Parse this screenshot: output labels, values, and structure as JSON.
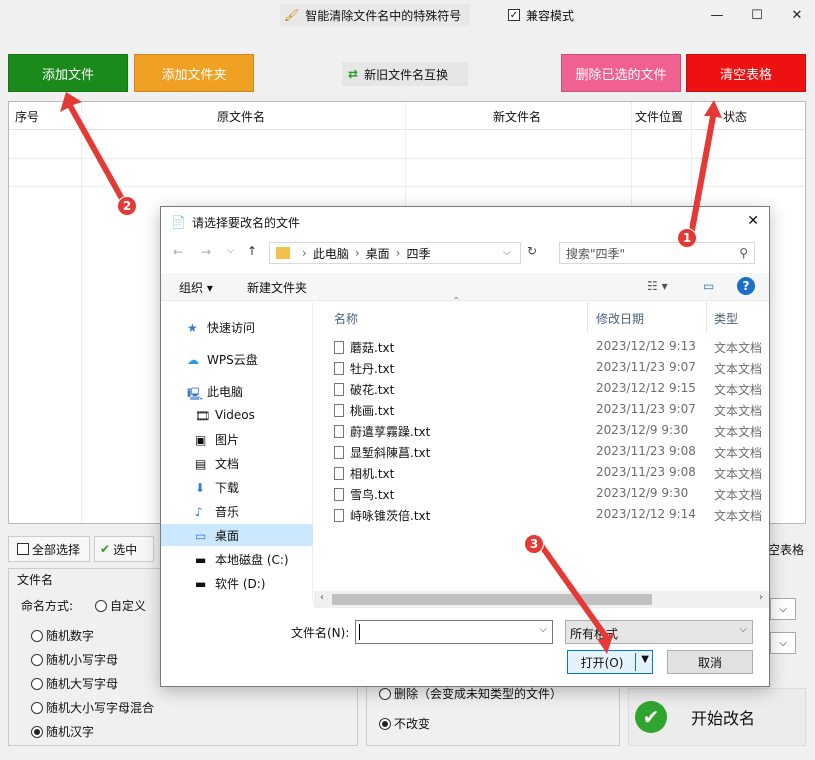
{
  "toolbar": {
    "special_char_btn": "智能清除文件名中的特殊符号",
    "compat_mode": "兼容模式",
    "add_file": "添加文件",
    "add_folder": "添加文件夹",
    "swap_names": "新旧文件名互换",
    "delete_selected": "删除已选的文件",
    "clear_table": "清空表格"
  },
  "colors": {
    "add_file": "#1a8a1a",
    "add_folder": "#f0a023",
    "delete_selected": "#f06090",
    "clear_table": "#ee1111"
  },
  "table": {
    "headers": [
      "序号",
      "原文件名",
      "新文件名",
      "文件位置",
      "状态"
    ]
  },
  "bottom": {
    "select_all": "全部选择",
    "select": "选中",
    "clear_table_short": "空表格",
    "section_filename": "文件名",
    "naming_mode_label": "命名方式:",
    "custom": "自定义",
    "random_digits": "随机数字",
    "random_lower": "随机小写字母",
    "random_upper": "随机大写字母",
    "random_mixed": "随机大小写字母混合",
    "random_chinese": "随机汉字",
    "delete_ext": "删除（会变成未知类型的文件）",
    "no_change": "不改变",
    "start": "开始改名"
  },
  "dialog": {
    "title": "请选择要改名的文件",
    "breadcrumb": [
      "此电脑",
      "桌面",
      "四季"
    ],
    "search_placeholder": "搜索\"四季\"",
    "organize": "组织 ▾",
    "new_folder": "新建文件夹",
    "nav": [
      {
        "label": "快速访问",
        "icon": "star-icon"
      },
      {
        "label": "WPS云盘",
        "icon": "cloud-icon"
      },
      {
        "label": "此电脑",
        "icon": "computer-icon"
      },
      {
        "label": "Videos",
        "icon": "video-icon"
      },
      {
        "label": "图片",
        "icon": "picture-icon"
      },
      {
        "label": "文档",
        "icon": "document-icon"
      },
      {
        "label": "下载",
        "icon": "download-icon"
      },
      {
        "label": "音乐",
        "icon": "music-icon"
      },
      {
        "label": "桌面",
        "icon": "desktop-icon"
      },
      {
        "label": "本地磁盘 (C:)",
        "icon": "drive-icon"
      },
      {
        "label": "软件 (D:)",
        "icon": "drive-icon"
      }
    ],
    "columns": [
      "名称",
      "修改日期",
      "类型"
    ],
    "files": [
      {
        "name": "蘑菇.txt",
        "date": "2023/12/12 9:13",
        "type": "文本文档"
      },
      {
        "name": "牡丹.txt",
        "date": "2023/11/23 9:07",
        "type": "文本文档"
      },
      {
        "name": "破花.txt",
        "date": "2023/12/12 9:15",
        "type": "文本文档"
      },
      {
        "name": "桃画.txt",
        "date": "2023/11/23 9:07",
        "type": "文本文档"
      },
      {
        "name": "蔚遣莩霧躁.txt",
        "date": "2023/12/9 9:30",
        "type": "文本文档"
      },
      {
        "name": "显堑斜陳菖.txt",
        "date": "2023/11/23 9:08",
        "type": "文本文档"
      },
      {
        "name": "相机.txt",
        "date": "2023/11/23 9:08",
        "type": "文本文档"
      },
      {
        "name": "雪鸟.txt",
        "date": "2023/12/9 9:30",
        "type": "文本文档"
      },
      {
        "name": "峙咏锥茨倍.txt",
        "date": "2023/12/12 9:14",
        "type": "文本文档"
      }
    ],
    "filename_label": "文件名(N):",
    "filetype": "所有格式",
    "open": "打开(O)",
    "cancel": "取消"
  },
  "annotations": [
    "1",
    "2",
    "3"
  ]
}
